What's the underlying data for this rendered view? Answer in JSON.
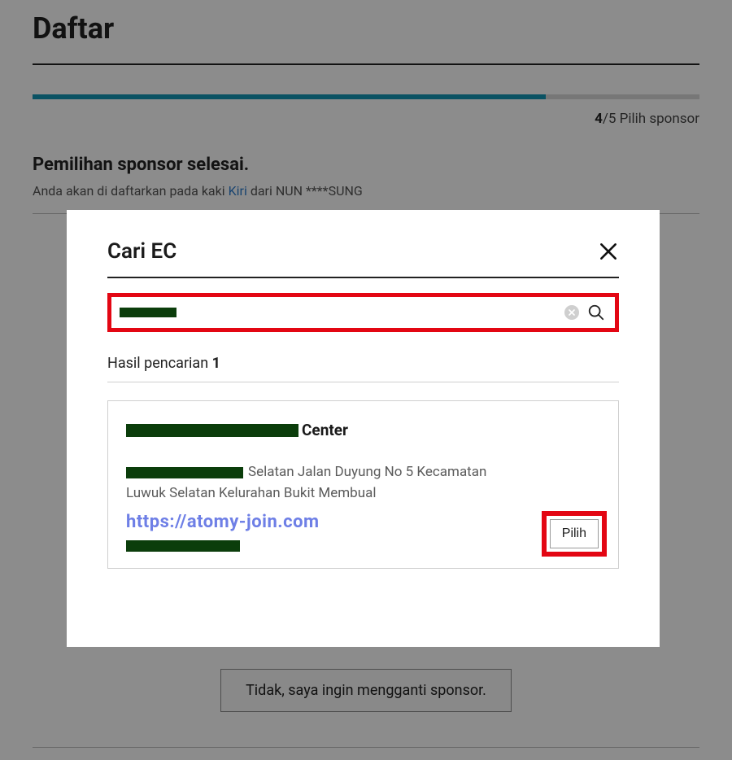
{
  "page": {
    "title": "Daftar",
    "progress_current": "4",
    "progress_total": "/5",
    "progress_step_name": " Pilih sponsor"
  },
  "sponsor": {
    "headline": "Pemilihan sponsor selesai.",
    "sub_prefix": "Anda akan di daftarkan pada kaki ",
    "leg": "Kiri",
    "sub_suffix": " dari NUN ****SUNG"
  },
  "change_btn": "Tidak, saya ingin mengganti sponsor.",
  "modal": {
    "title": "Cari EC",
    "search_value": "",
    "results_label_prefix": "Hasil pencarian ",
    "results_count": "1"
  },
  "result": {
    "name_suffix": "Center",
    "addr_tail1": "Selatan Jalan Duyung No 5 Kecamatan",
    "addr_line2": "Luwuk Selatan Kelurahan Bukit Membual",
    "watermark": "https://atomy-join.com",
    "select_btn": "Pilih"
  }
}
